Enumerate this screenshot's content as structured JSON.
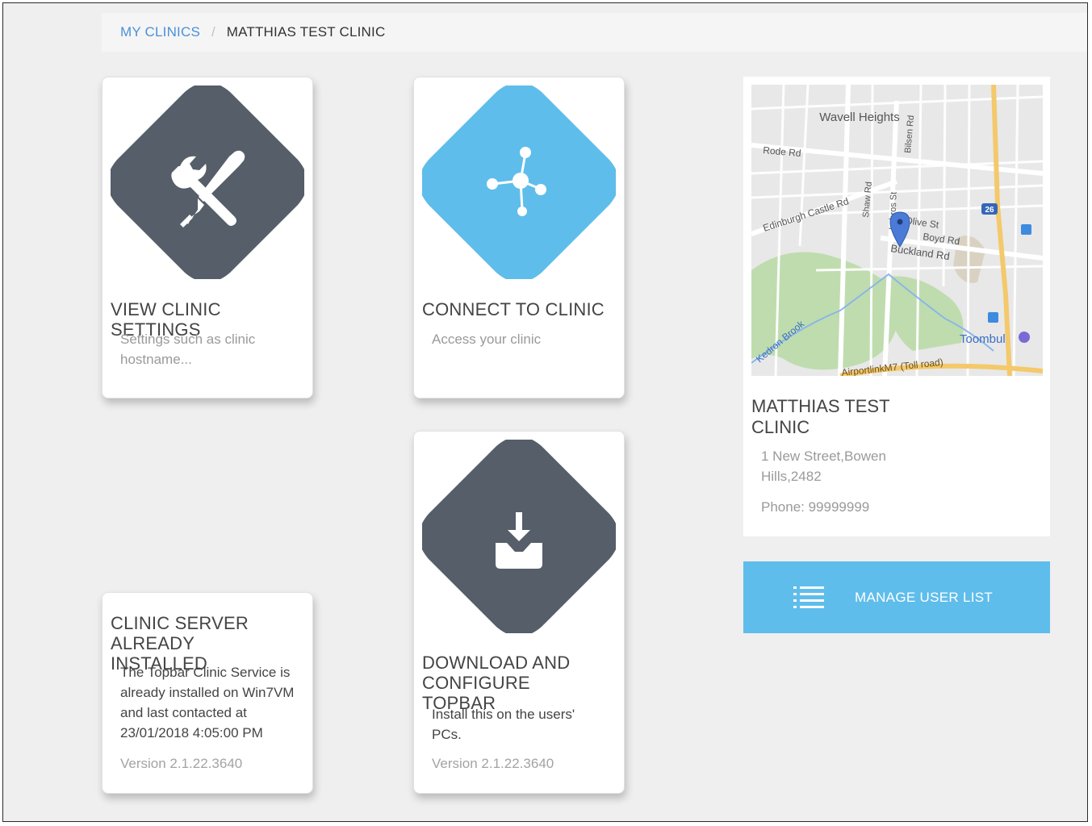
{
  "breadcrumb": {
    "root": "MY CLINICS",
    "separator": "/",
    "current": "MATTHIAS TEST CLINIC"
  },
  "cards": {
    "settings": {
      "title": "VIEW CLINIC SETTINGS",
      "description": "Settings such as clinic hostname...",
      "icon": "tools-icon",
      "color": "#555e69"
    },
    "connect": {
      "title": "CONNECT TO CLINIC",
      "description": "Access your clinic",
      "icon": "network-hub-icon",
      "color": "#5fbdeb"
    },
    "server": {
      "title": "CLINIC SERVER ALREADY INSTALLED",
      "description": "The Topbar Clinic Service is already installed on Win7VM and last contacted at 23/01/2018 4:05:00 PM",
      "version": "Version 2.1.22.3640"
    },
    "download": {
      "title": "DOWNLOAD AND CONFIGURE TOPBAR",
      "description": "Install this on the users' PCs.",
      "version": "Version 2.1.22.3640",
      "icon": "download-tray-icon",
      "color": "#555e69"
    }
  },
  "map": {
    "suburbs": [
      "Wavell Heights",
      "Toombul"
    ],
    "roads": [
      "Rode Rd",
      "Edinburgh Castle Rd",
      "Shaw Rd",
      "Imbros St",
      "Bilsen Rd",
      "Olive St",
      "Boyd Rd",
      "Buckland Rd",
      "Kedron Brook",
      "AirportlinkM7 (Toll road)"
    ],
    "route_badge": "26"
  },
  "clinic": {
    "name": "MATTHIAS TEST CLINIC",
    "address": "1 New Street,Bowen Hills,2482",
    "phone": "Phone: 99999999"
  },
  "actions": {
    "manage_users": "MANAGE USER LIST"
  },
  "colors": {
    "accent": "#5fbdeb",
    "dark": "#555e69",
    "link": "#4a90d9",
    "background": "#efefef"
  }
}
